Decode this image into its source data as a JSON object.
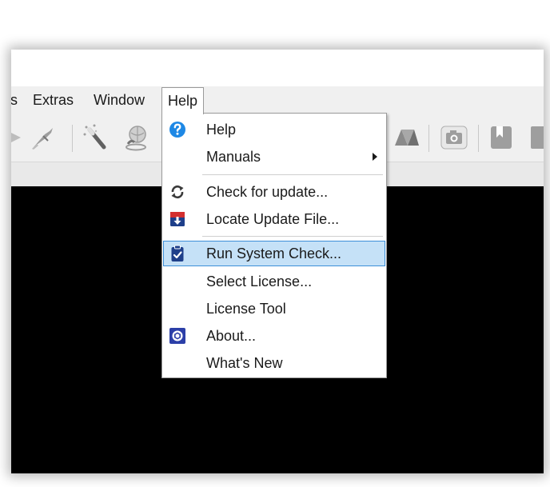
{
  "menubar": {
    "items": [
      {
        "label": "s"
      },
      {
        "label": "Extras"
      },
      {
        "label": "Window"
      },
      {
        "label": "Help"
      }
    ]
  },
  "help_menu": {
    "items": [
      {
        "label": "Help",
        "icon": "help-circle-icon"
      },
      {
        "label": "Manuals",
        "has_submenu": true
      },
      {
        "label": "Check for update...",
        "icon": "refresh-icon"
      },
      {
        "label": "Locate Update File...",
        "icon": "download-box-icon"
      },
      {
        "label": "Run System Check...",
        "icon": "clipboard-check-icon",
        "highlighted": true
      },
      {
        "label": "Select License..."
      },
      {
        "label": "License Tool"
      },
      {
        "label": "About...",
        "icon": "app-logo-icon"
      },
      {
        "label": "What's New"
      }
    ]
  },
  "toolbar": {
    "icons": [
      "play-icon",
      "scalpel-icon",
      "magic-wand-icon",
      "globe-hand-icon",
      "triangles-icon",
      "camera-icon",
      "bookmark-icon",
      "page-icon"
    ]
  },
  "colors": {
    "highlight_bg": "#c5e1f7",
    "highlight_border": "#3d8fd8",
    "help_icon_blue": "#1e88e5",
    "viewport": "#000000"
  }
}
